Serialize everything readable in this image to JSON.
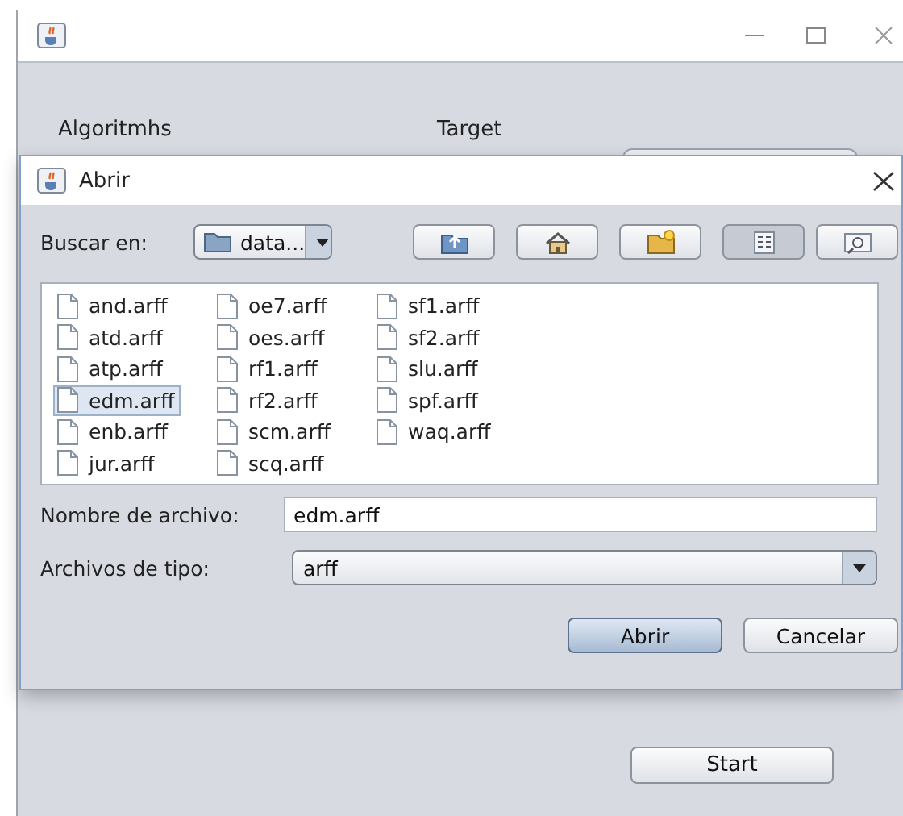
{
  "main_window": {
    "labels": [
      "Algoritmhs",
      "Target"
    ]
  },
  "dialog": {
    "title": "Abrir",
    "look_in": {
      "label": "Buscar en:",
      "value": "data..."
    },
    "toolbar": [
      {
        "kind": "up",
        "pressed": false
      },
      {
        "kind": "home",
        "pressed": false
      },
      {
        "kind": "new-folder",
        "pressed": false
      },
      {
        "kind": "list",
        "pressed": true
      },
      {
        "kind": "details",
        "pressed": false
      }
    ],
    "files": [
      {
        "name": "and.arff",
        "selected": false
      },
      {
        "name": "atd.arff",
        "selected": false
      },
      {
        "name": "atp.arff",
        "selected": false
      },
      {
        "name": "edm.arff",
        "selected": true
      },
      {
        "name": "enb.arff",
        "selected": false
      },
      {
        "name": "jur.arff",
        "selected": false
      },
      {
        "name": "oe7.arff",
        "selected": false
      },
      {
        "name": "oes.arff",
        "selected": false
      },
      {
        "name": "rf1.arff",
        "selected": false
      },
      {
        "name": "rf2.arff",
        "selected": false
      },
      {
        "name": "scm.arff",
        "selected": false
      },
      {
        "name": "scq.arff",
        "selected": false
      },
      {
        "name": "sf1.arff",
        "selected": false
      },
      {
        "name": "sf2.arff",
        "selected": false
      },
      {
        "name": "slu.arff",
        "selected": false
      },
      {
        "name": "spf.arff",
        "selected": false
      },
      {
        "name": "waq.arff",
        "selected": false
      }
    ],
    "file_name": {
      "label": "Nombre de archivo:",
      "value": "edm.arff"
    },
    "file_type": {
      "label": "Archivos de tipo:",
      "value": "arff"
    },
    "buttons": [
      {
        "label": "Abrir",
        "kind": "primary"
      },
      {
        "label": "Cancelar",
        "kind": "default"
      }
    ]
  },
  "start_button": "Start"
}
